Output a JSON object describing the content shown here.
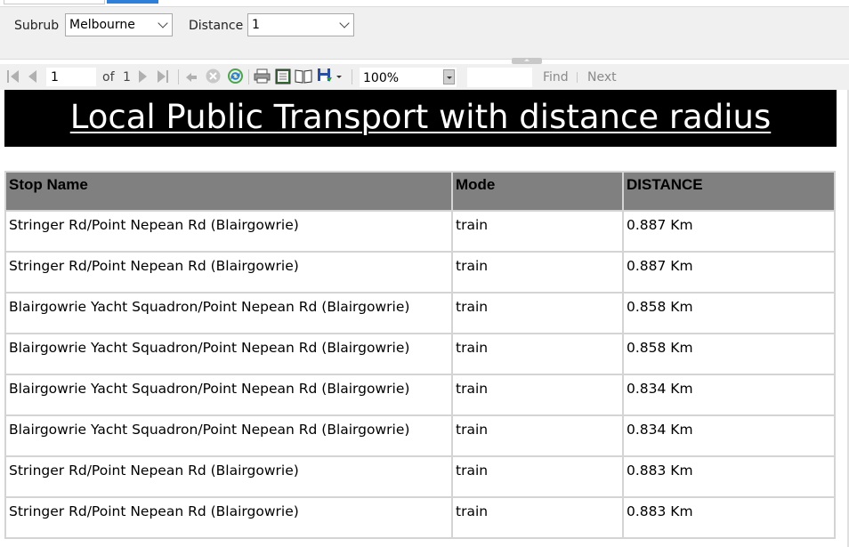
{
  "params": {
    "suburb_label": "Subrub",
    "suburb_value": "Melbourne",
    "distance_label": "Distance",
    "distance_value": "1"
  },
  "toolbar": {
    "page_current": "1",
    "page_of": "of",
    "page_total": "1",
    "zoom": "100%",
    "find_label": "Find",
    "next_label": "Next"
  },
  "report": {
    "title": "Local Public Transport with distance radius",
    "columns": [
      "Stop Name",
      "Mode",
      "DISTANCE"
    ],
    "rows": [
      [
        "Stringer Rd/Point Nepean Rd (Blairgowrie)",
        "train",
        "0.887 Km"
      ],
      [
        "Stringer Rd/Point Nepean Rd (Blairgowrie)",
        "train",
        "0.887 Km"
      ],
      [
        "Blairgowrie Yacht Squadron/Point Nepean Rd (Blairgowrie)",
        "train",
        "0.858 Km"
      ],
      [
        "Blairgowrie Yacht Squadron/Point Nepean Rd (Blairgowrie)",
        "train",
        "0.858 Km"
      ],
      [
        "Blairgowrie Yacht Squadron/Point Nepean Rd (Blairgowrie)",
        "train",
        "0.834 Km"
      ],
      [
        "Blairgowrie Yacht Squadron/Point Nepean Rd (Blairgowrie)",
        "train",
        "0.834 Km"
      ],
      [
        "Stringer Rd/Point Nepean Rd (Blairgowrie)",
        "train",
        "0.883 Km"
      ],
      [
        "Stringer Rd/Point Nepean Rd (Blairgowrie)",
        "train",
        "0.883 Km"
      ]
    ]
  },
  "colors": {
    "header_bg": "#808080",
    "title_bg": "#000000",
    "title_fg": "#ffffff",
    "toolbar_bg": "#f0f0f0"
  },
  "icons": [
    "first-page-icon",
    "prev-page-icon",
    "next-page-icon",
    "last-page-icon",
    "back-icon",
    "stop-icon",
    "refresh-icon",
    "print-icon",
    "print-layout-icon",
    "page-setup-icon",
    "export-save-icon"
  ]
}
